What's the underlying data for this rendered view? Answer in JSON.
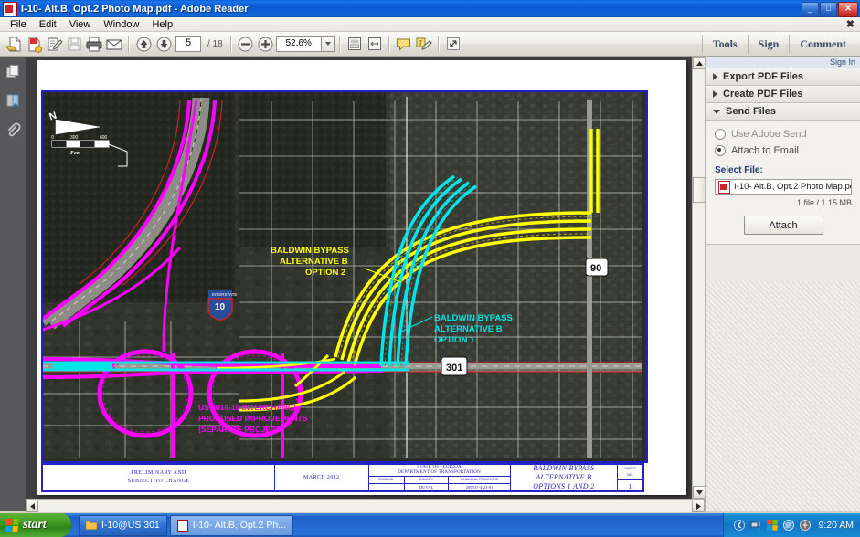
{
  "window": {
    "title": "I-10- Alt.B, Opt.2 Photo Map.pdf - Adobe Reader",
    "icon": "pdf-document-icon",
    "minimize_label": "_",
    "maximize_label": "❐",
    "close_label": "✕"
  },
  "menu": {
    "items": [
      {
        "label": "File"
      },
      {
        "label": "Edit"
      },
      {
        "label": "View"
      },
      {
        "label": "Window"
      },
      {
        "label": "Help"
      }
    ],
    "close_label": "✖"
  },
  "toolbar": {
    "buttons": [
      {
        "name": "open-file-icon"
      },
      {
        "name": "create-pdf-icon"
      },
      {
        "name": "sign-edit-icon"
      },
      {
        "name": "save-icon"
      },
      {
        "name": "print-icon"
      },
      {
        "name": "email-icon"
      }
    ],
    "page_up_icon": "arrow-up-icon",
    "page_down_icon": "arrow-down-icon",
    "page_number": "5",
    "page_total": "/ 18",
    "zoom_out_icon": "minus-icon",
    "zoom_in_icon": "plus-icon",
    "zoom_level": "52.6%",
    "zoom_dropdown_icon": "chevron-down-icon",
    "fit_page_icon": "fit-page-icon",
    "fit_width_icon": "fit-width-icon",
    "comment_balloon_icon": "comment-icon",
    "text_comment_icon": "text-comment-icon",
    "fullscreen_icon": "fullscreen-icon",
    "right_items": [
      {
        "label": "Tools"
      },
      {
        "label": "Sign"
      },
      {
        "label": "Comment"
      }
    ]
  },
  "navrail": {
    "items": [
      {
        "name": "page-thumbnails-icon"
      },
      {
        "name": "bookmarks-icon"
      },
      {
        "name": "attachments-icon"
      }
    ]
  },
  "right_panel": {
    "sign_in": "Sign In",
    "sections": [
      {
        "label": "Export PDF Files",
        "expanded": false
      },
      {
        "label": "Create PDF Files",
        "expanded": false
      },
      {
        "label": "Send Files",
        "expanded": true
      }
    ],
    "send_files": {
      "option_adobe_send": "Use Adobe Send",
      "option_attach_email": "Attach to Email",
      "selected_option": "Attach to Email",
      "select_file_label": "Select File:",
      "file_name": "I-10- Alt.B, Opt.2 Photo Map.pdf",
      "file_summary": "1 file / 1.15 MB",
      "attach_button": "Attach"
    }
  },
  "document": {
    "map": {
      "north_arrow_label": "N",
      "scale_bar": {
        "min": "0",
        "mid": "300",
        "max": "600",
        "units": "Feet"
      },
      "shield_i10": "10",
      "shield_i10_top": "INTERSTATE",
      "shield_us301": "301",
      "shield_us90": "90",
      "labels": [
        {
          "text_lines": [
            "BALDWIN BYPASS",
            "ALTERNATIVE B",
            "OPTION 2"
          ],
          "color": "#ffff00"
        },
        {
          "text_lines": [
            "BALDWIN BYPASS",
            "ALTERNATIVE B",
            "OPTION 1"
          ],
          "color": "#00e5e5"
        },
        {
          "text_lines": [
            "US 301/I-10 INTERCHANGE",
            "PROPOSED IMPROVEMENTS",
            "(SEPARATE PROJECT)"
          ],
          "color": "#ff00ff"
        }
      ]
    },
    "title_block": {
      "status_line1": "PRELIMINARY AND",
      "status_line2": "SUBJECT TO CHANGE",
      "date": "MARCH 2012",
      "agency_line1": "STATE OF FLORIDA",
      "agency_line2": "DEPARTMENT OF TRANSPORTATION",
      "col_headers": [
        "ROAD NO.",
        "COUNTY",
        "FINANCIAL PROJECT ID"
      ],
      "col_values": [
        "",
        "DUVAL",
        "209537-4-22-01"
      ],
      "project_line1": "BALDWIN BYPASS",
      "project_line2": "ALTERNATIVE B",
      "project_line3": "OPTIONS 1 AND 2",
      "sheet_label_line1": "SHEET",
      "sheet_label_line2": "NO.",
      "sheet_number": "1"
    }
  },
  "taskbar": {
    "start_label": "start",
    "items": [
      {
        "label": "I-10@US 301",
        "icon": "folder-icon",
        "active": false
      },
      {
        "label": "I-10- Alt.B, Opt.2 Ph...",
        "icon": "pdf-document-icon",
        "active": true
      }
    ],
    "tray_icons": [
      {
        "name": "show-desktop-icon"
      },
      {
        "name": "network-icon"
      },
      {
        "name": "windows-security-icon"
      },
      {
        "name": "messenger-icon"
      },
      {
        "name": "shield-icon"
      }
    ],
    "clock": "9:20 AM"
  }
}
